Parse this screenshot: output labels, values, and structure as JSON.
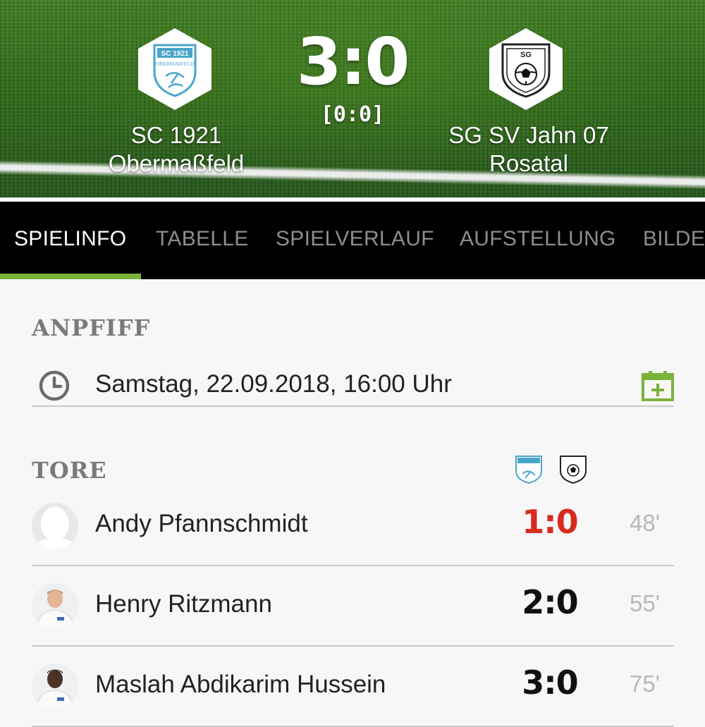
{
  "match": {
    "home_team_line1": "SC 1921",
    "home_team_line2": "Obermaßfeld",
    "away_team_line1": "SG SV Jahn 07",
    "away_team_line2": "Rosatal",
    "score": "3:0",
    "halftime": "[0:0]",
    "home_logo_text_top": "SC 1921",
    "home_logo_text_bottom": "OBERMAßFELD",
    "away_logo_text": "SG"
  },
  "tabs": [
    {
      "label": "SPIELINFO",
      "active": true
    },
    {
      "label": "TABELLE"
    },
    {
      "label": "SPIELVERLAUF"
    },
    {
      "label": "AUFSTELLUNG"
    },
    {
      "label": "BILDE"
    }
  ],
  "kickoff": {
    "title": "ANPFIFF",
    "datetime": "Samstag, 22.09.2018, 16:00 Uhr",
    "icon": "clock-icon",
    "action_icon": "calendar-add-icon"
  },
  "goals": {
    "title": "TORE",
    "items": [
      {
        "player": "Andy Pfannschmidt",
        "score": "1:0",
        "minute": "48'",
        "highlight": true
      },
      {
        "player": "Henry Ritzmann",
        "score": "2:0",
        "minute": "55'"
      },
      {
        "player": "Maslah Abdikarim Hussein",
        "score": "3:0",
        "minute": "75'"
      }
    ]
  },
  "colors": {
    "accent_green": "#7bb33a",
    "highlight_red": "#d92a1f",
    "tab_bar": "#000000"
  }
}
